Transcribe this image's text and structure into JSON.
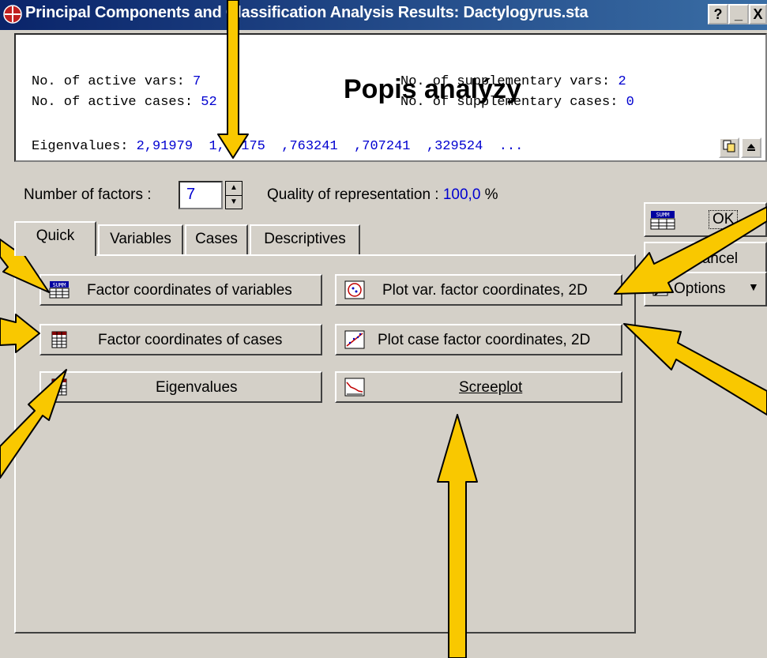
{
  "window": {
    "title": "Principal Components and Classification Analysis Results: Dactylogyrus.sta",
    "help_btn": "?",
    "min_btn": "_",
    "close_btn": "X"
  },
  "summary": {
    "active_vars_label": "No. of active vars: ",
    "active_vars_value": "7",
    "active_cases_label": "No. of active cases: ",
    "active_cases_value": "52",
    "supp_vars_label": "No. of supplementary vars: ",
    "supp_vars_value": "2",
    "supp_cases_label": "No. of supplementary cases: ",
    "supp_cases_value": "0",
    "eigen_label": "Eigenvalues: ",
    "eigen_values": "2,91979  1,84175  ,763241  ,707241  ,329524  ...",
    "overlay_title": "Popis analýzy"
  },
  "controls": {
    "num_factors_label": "Number of factors :",
    "num_factors_value": "7",
    "quality_label": "Quality of representation : ",
    "quality_value": "100,0",
    "quality_unit": " %"
  },
  "tabs": [
    {
      "label": "Quick"
    },
    {
      "label": "Variables"
    },
    {
      "label": "Cases"
    },
    {
      "label": "Descriptives"
    }
  ],
  "buttons": {
    "factor_coords_vars": "Factor coordinates of variables",
    "factor_coords_cases": "Factor coordinates of cases",
    "eigenvalues": "Eigenvalues",
    "plot_var_coords": "Plot var. factor coordinates, 2D",
    "plot_case_coords": "Plot case factor coordinates, 2D",
    "screeplot": "Screeplot"
  },
  "side": {
    "ok": "OK",
    "cancel": "Cancel",
    "options": "Options"
  },
  "icon_colors": {
    "arrow_fill": "#f9c800",
    "title_bar": "#0a246a"
  }
}
